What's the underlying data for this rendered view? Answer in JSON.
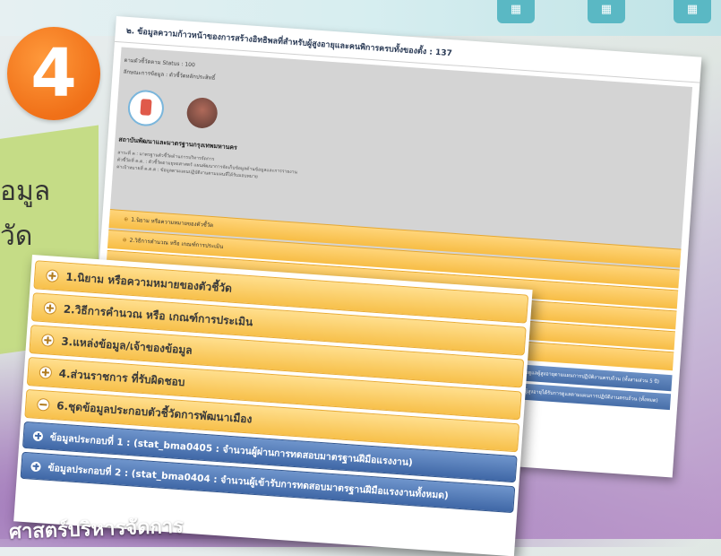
{
  "step_number": "4",
  "side_text": [
    "อมูล",
    "วัด"
  ],
  "bottom_text": "ศาสตร์บริหารจัดการ",
  "back_panel": {
    "title": "๒. ข้อมูลความก้าวหน้าของการสร้างอิทธิพลที่สำหรับผู้สูงอายุและคนพิการครบทั้งของตั้ง : 137",
    "meta": [
      "ตามตัวชี้วัดตาม Status : 100",
      "ลักษณะการข้อมูล : ตัวชี้วัดหลักประสิทธิ์"
    ],
    "org_title": "สถาบันพัฒนาและมาตรฐานกรุงเทพมหานคร",
    "org_desc": [
      "สาระที่ ค : มาตรฐานตัวชี้วัดด้านการบริหารจัดการ",
      "ตัวชี้วัดที่ ค.ต. : ตัวชี้วัดตามยุทธศาสตร์ แผนพัฒนาการจัดเก็บข้อมูลด้านข้อมูลและการรายงาน",
      "ค่าเป้าหมายที่ ค.ต.ต : ข้อมูลตามแผนปฏิบัติงานตามแผนที่ได้รับมอบหมาย"
    ],
    "rows": [
      "1.นิยาม หรือความหมายของตัวชี้วัด",
      "2.วิธีการคำนวณ หรือ เกณฑ์การประเมิน",
      "",
      "",
      "",
      ""
    ],
    "blue_rows": [
      "มีการดูแลผู้สูงอายุตามแผนการปฏิบัติงานครบถ้วน (ทั้งสามส่วน 5 ปี)",
      "ผู้สูงอายุได้รับการดูแลตามแผนการปฏิบัติงานครบถ้วน (ทั้งหมด)"
    ]
  },
  "accordion": {
    "items": [
      {
        "label": "1.นิยาม หรือความหมายของตัวชี้วัด",
        "expanded": false
      },
      {
        "label": "2.วิธีการคำนวณ หรือ เกณฑ์การประเมิน",
        "expanded": false
      },
      {
        "label": "3.แหล่งข้อมูล/เจ้าของข้อมูล",
        "expanded": false
      },
      {
        "label": "4.ส่วนราชการ ที่รับผิดชอบ",
        "expanded": false
      },
      {
        "label": "6.ชุดข้อมูลประกอบตัวชี้วัดการพัฒนาเมือง",
        "expanded": true
      }
    ],
    "sub_items": [
      {
        "label": "ข้อมูลประกอบที่ 1 : (stat_bma0405 : จำนวนผู้ผ่านการทดสอบมาตรฐานฝีมือแรงงาน)"
      },
      {
        "label": "ข้อมูลประกอบที่ 2 : (stat_bma0404 : จำนวนผู้เข้ารับการทดสอบมาตรฐานฝีมือแรงงานทั้งหมด)"
      }
    ]
  },
  "colors": {
    "accordion_yellow": "#f7c04a",
    "accordion_blue": "#476ea8",
    "badge_orange": "#f07018"
  }
}
